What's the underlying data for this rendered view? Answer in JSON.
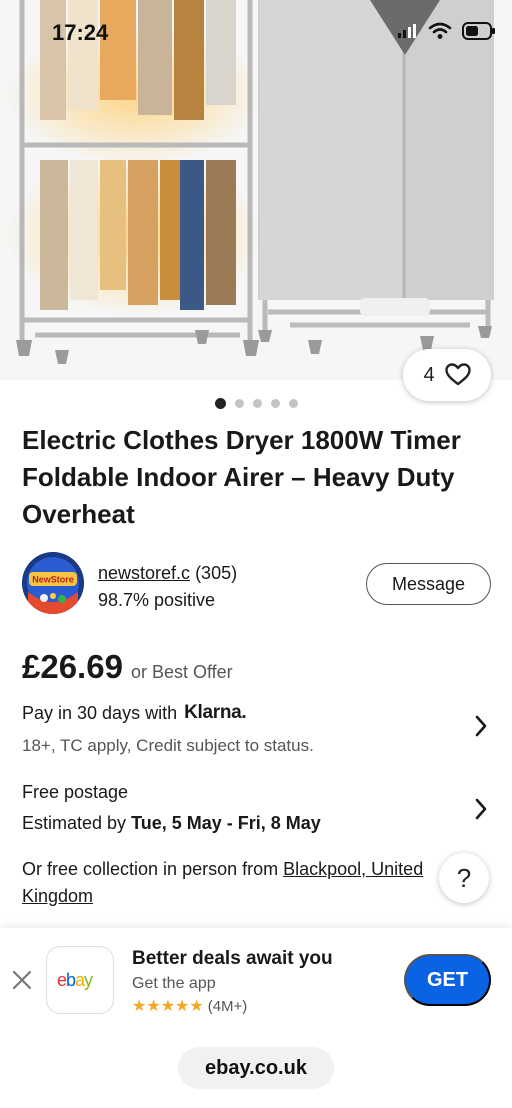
{
  "status_bar": {
    "time": "17:24"
  },
  "listing": {
    "watch_count": "4",
    "image_dots": 5,
    "active_dot": 0,
    "title": "Electric Clothes Dryer 1800W Timer Foldable Indoor Airer – Heavy Duty Overheat"
  },
  "seller": {
    "name": "newstoref.c",
    "feedback_count": "(305)",
    "positive": "98.7% positive",
    "message_label": "Message",
    "avatar_text": "NewStore"
  },
  "price": {
    "amount": "£26.69",
    "offer": "or Best Offer"
  },
  "klarna": {
    "prefix": "Pay in 30 days with",
    "brand": "Klarna.",
    "terms": "18+, TC apply, Credit subject to status."
  },
  "postage": {
    "line1": "Free postage",
    "estimated_prefix": "Estimated by",
    "estimated_dates": "Tue, 5 May - Fri, 8 May"
  },
  "collection": {
    "prefix": "Or free collection in person from",
    "location": "Blackpool, United Kingdom"
  },
  "help": {
    "label": "?"
  },
  "app_banner": {
    "logo_text": "ebay",
    "title": "Better deals await you",
    "subtitle": "Get the app",
    "stars": "★★★★★",
    "rating_count": "(4M+)",
    "get_label": "GET"
  },
  "browser": {
    "url": "ebay.co.uk"
  },
  "colors": {
    "accent_blue": "#0a63e3",
    "star": "#f5a623",
    "ebay_red": "#e53238",
    "ebay_blue": "#0064d2",
    "ebay_yellow": "#f5af02",
    "ebay_green": "#86b817"
  }
}
